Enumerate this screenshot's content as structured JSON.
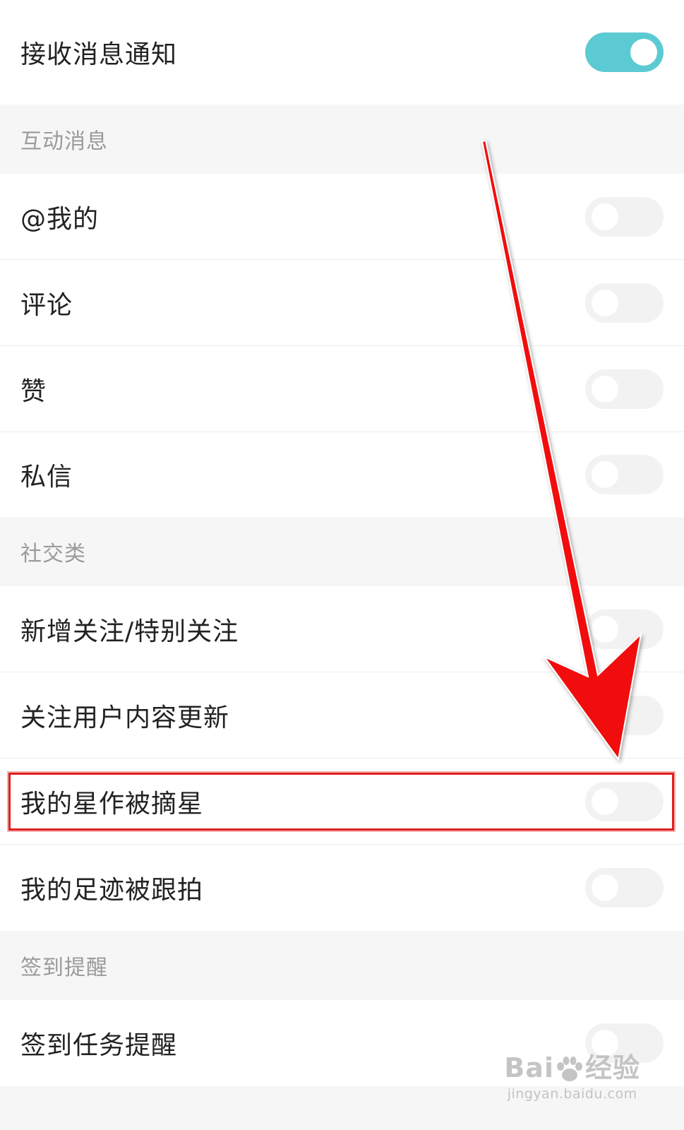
{
  "master": {
    "label": "接收消息通知",
    "enabled": true
  },
  "sections": [
    {
      "title": "互动消息",
      "items": [
        {
          "label": "@我的",
          "enabled": false
        },
        {
          "label": "评论",
          "enabled": false
        },
        {
          "label": "赞",
          "enabled": false
        },
        {
          "label": "私信",
          "enabled": false
        }
      ]
    },
    {
      "title": "社交类",
      "items": [
        {
          "label": "新增关注/特别关注",
          "enabled": false
        },
        {
          "label": "关注用户内容更新",
          "enabled": false
        },
        {
          "label": "我的星作被摘星",
          "enabled": false
        },
        {
          "label": "我的足迹被跟拍",
          "enabled": false
        }
      ]
    },
    {
      "title": "签到提醒",
      "items": [
        {
          "label": "签到任务提醒",
          "enabled": false
        }
      ]
    }
  ],
  "colors": {
    "toggle_on": "#5ccad2",
    "toggle_off": "#f2f2f2",
    "annotation": "#e02020"
  },
  "watermark": {
    "logo_a": "Bai",
    "logo_b": "经验",
    "url": "jingyan.baidu.com"
  }
}
